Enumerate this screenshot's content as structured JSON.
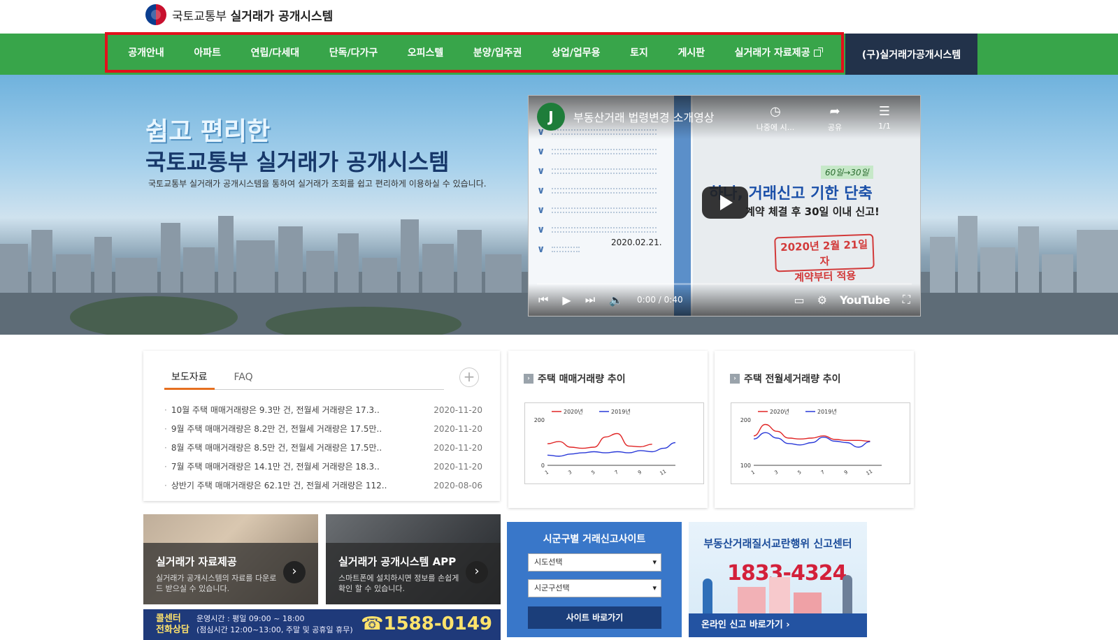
{
  "header": {
    "ministry": "국토교통부",
    "system": "실거래가 공개시스템"
  },
  "nav": {
    "items": [
      "공개안내",
      "아파트",
      "연립/다세대",
      "단독/다가구",
      "오피스텔",
      "분양/입주권",
      "상업/업무용",
      "토지",
      "게시판",
      "실거래가 자료제공"
    ],
    "old_system": "(구)실거래가공개시스템"
  },
  "hero": {
    "title1": "쉽고 편리한",
    "title2": "국토교통부 실거래가 공개시스템",
    "desc": "국토교통부 실거래가 공개시스템을 통하여 실거래가 조회를 쉽고 편리하게 이용하실 수 있습니다."
  },
  "video": {
    "channel_initial": "J",
    "title": "부동산거래 법령변경 소개영상",
    "watch_later": "나중에 시...",
    "share": "공유",
    "playlist": "1/1",
    "promo_tag": "60일→30일",
    "promo_head": "하나, 거래신고 기한 단축",
    "promo_sub": "계약 체결 후 30일 이내 신고!",
    "stamp_line1": "2020년 2월 21일자",
    "stamp_line2": "계약부터 적용",
    "date": "2020.02.21.",
    "time": "0:00 / 0:40",
    "brand": "YouTube",
    "icons": {
      "clock": "clock-icon",
      "share": "share-icon",
      "playlist": "playlist-icon",
      "prev": "skip-previous-icon",
      "play": "play-icon",
      "next": "skip-next-icon",
      "volume": "volume-icon",
      "subtitles": "subtitles-icon",
      "settings": "settings-icon",
      "fullscreen": "fullscreen-icon"
    }
  },
  "news": {
    "tabs": [
      "보도자료",
      "FAQ"
    ],
    "items": [
      {
        "title": "10월 주택 매매거래량은 9.3만 건, 전월세 거래량은 17.3..",
        "date": "2020-11-20"
      },
      {
        "title": "9월 주택 매매거래량은 8.2만 건, 전월세 거래량은 17.5만..",
        "date": "2020-11-20"
      },
      {
        "title": "8월 주택 매매거래량은 8.5만 건, 전월세 거래량은 17.5만..",
        "date": "2020-11-20"
      },
      {
        "title": "7월 주택 매매거래량은 14.1만 건, 전월세 거래량은 18.3..",
        "date": "2020-11-20"
      },
      {
        "title": "상반기 주택 매매거래량은 62.1만 건, 전월세 거래량은 112..",
        "date": "2020-08-06"
      }
    ]
  },
  "chart_data": [
    {
      "type": "line",
      "title": "주택 매매거래량 추이",
      "x": [
        1,
        2,
        3,
        4,
        5,
        6,
        7,
        8,
        9,
        10,
        11,
        12
      ],
      "xticks": [
        "1",
        "3",
        "5",
        "7",
        "9",
        "11"
      ],
      "yticks": [
        0,
        200
      ],
      "ylim": [
        0,
        200
      ],
      "legend": "top-left",
      "series": [
        {
          "name": "2020년",
          "color": "#e02424",
          "values": [
            95,
            105,
            80,
            75,
            80,
            125,
            140,
            85,
            82,
            93,
            null,
            null
          ]
        },
        {
          "name": "2019년",
          "color": "#2838d8",
          "values": [
            45,
            40,
            50,
            55,
            60,
            55,
            60,
            55,
            65,
            60,
            75,
            100
          ]
        }
      ]
    },
    {
      "type": "line",
      "title": "주택 전월세거래량 추이",
      "x": [
        1,
        2,
        3,
        4,
        5,
        6,
        7,
        8,
        9,
        10,
        11,
        12
      ],
      "xticks": [
        "1",
        "3",
        "5",
        "7",
        "9",
        "11"
      ],
      "yticks": [
        100,
        200
      ],
      "ylim": [
        100,
        200
      ],
      "legend": "top-left",
      "series": [
        {
          "name": "2020년",
          "color": "#e02424",
          "values": [
            165,
            190,
            175,
            160,
            158,
            160,
            165,
            157,
            155,
            155,
            153,
            null
          ]
        },
        {
          "name": "2019년",
          "color": "#2838d8",
          "values": [
            158,
            172,
            160,
            148,
            145,
            150,
            162,
            153,
            150,
            140,
            152,
            null
          ]
        }
      ]
    }
  ],
  "tiles": [
    {
      "title": "실거래가 자료제공",
      "desc": "실거래가 공개시스템의 자료를 다운로드 받으실 수 있습니다."
    },
    {
      "title": "실거래가 공개시스템 APP",
      "desc": "스마트폰에 설치하시면 정보를 손쉽게 확인 할 수 있습니다."
    }
  ],
  "callcenter": {
    "title1": "콜센터",
    "title2": "전화상담",
    "hours": "운영시간 : 평일 09:00 ~ 18:00",
    "lunch": "(점심시간 12:00~13:00, 주말 및 공휴일 휴무)",
    "phone": "☎1588-0149"
  },
  "report": {
    "title": "시군구별 거래신고사이트",
    "sido_placeholder": "시도선택",
    "sigungu_placeholder": "시군구선택",
    "button": "사이트 바로가기"
  },
  "banner": {
    "title": "부동산거래질서교란행위 신고센터",
    "phone": "1833-4324",
    "link": "온라인 신고 바로가기 ›"
  },
  "colors": {
    "nav_green": "#38a54a",
    "nav_highlight": "#e3101c",
    "old_system_bg": "#22324a",
    "report_blue": "#3977c9"
  }
}
